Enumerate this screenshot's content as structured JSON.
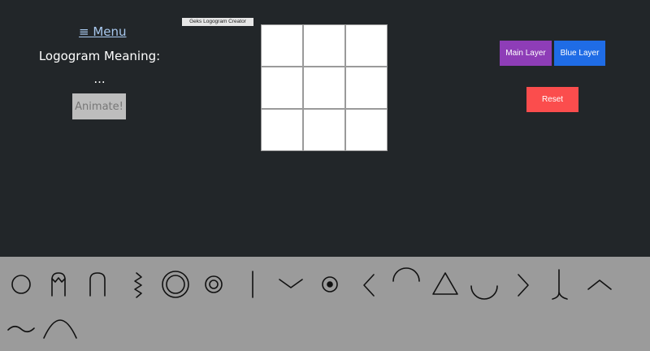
{
  "sidebar": {
    "menu_label": "≡ Menu",
    "meaning_label": "Logogram Meaning:",
    "meaning_value": "...",
    "animate_label": "Animate!"
  },
  "title_badge": "Geks Logogram Creator",
  "grid": {
    "rows": 3,
    "cols": 3
  },
  "layers": {
    "main_label": "Main Layer",
    "blue_label": "Blue Layer",
    "reset_label": "Reset"
  },
  "palette": {
    "glyphs": [
      "circle-glyph",
      "arch-crown-glyph",
      "arch-glyph",
      "zigzag-glyph",
      "double-circle-glyph",
      "ring-glyph",
      "vertical-line-glyph",
      "chevron-down-glyph",
      "dot-circle-glyph",
      "chevron-left-glyph",
      "semicircle-top-glyph",
      "triangle-glyph",
      "semicircle-bottom-glyph",
      "chevron-right-glyph",
      "hook-glyph",
      "caret-up-glyph",
      "tilde-glyph",
      "hill-glyph"
    ]
  },
  "colors": {
    "background": "#222629",
    "palette_bg": "#9b9b9b",
    "main_layer": "#8e3db7",
    "blue_layer": "#1f6ce6",
    "reset": "#fb4d4d"
  }
}
